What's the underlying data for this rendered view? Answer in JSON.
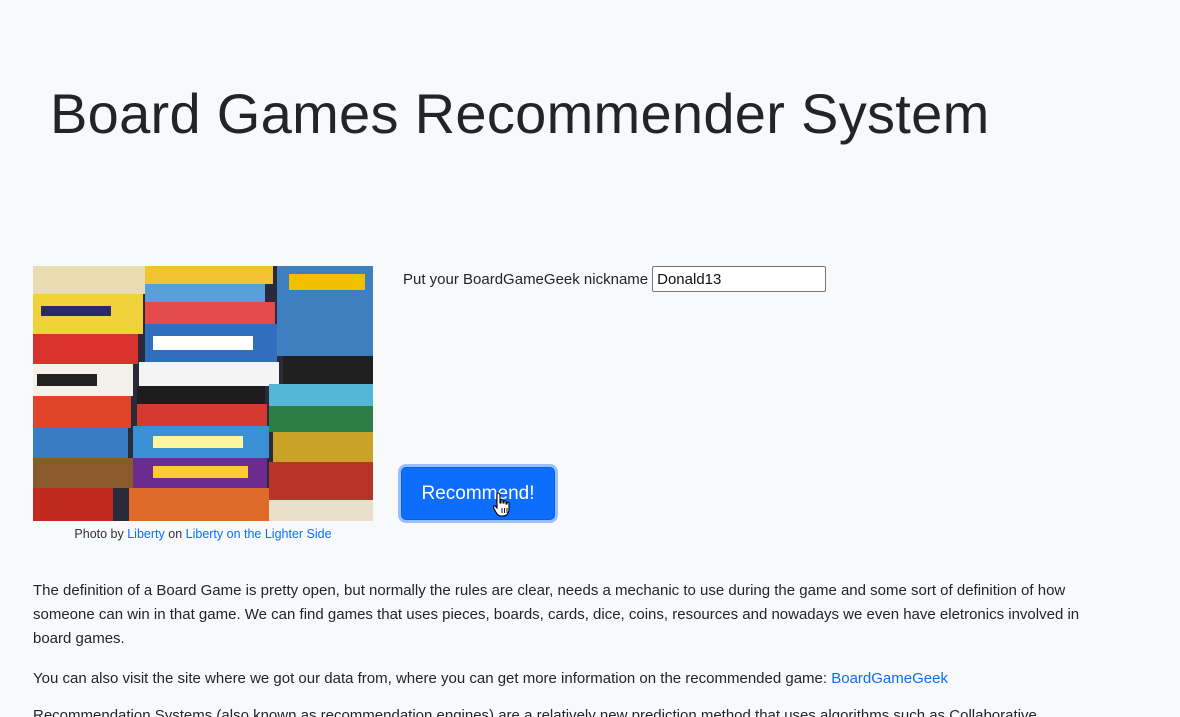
{
  "header": {
    "title": "Board Games Recommender System"
  },
  "photo": {
    "caption_prefix": "Photo by",
    "author_link": "Liberty",
    "caption_middle": "on",
    "source_link": "Liberty on the Lighter Side"
  },
  "form": {
    "nickname_label": "Put your BoardGameGeek nickname",
    "nickname_value": "Donald13",
    "submit_label": "Recommend!"
  },
  "content": {
    "paragraph1": "The definition of a Board Game is pretty open, but normally the rules are clear, needs a mechanic to use during the game and some sort of definition of how someone can win in that game. We can find games that uses pieces, boards, cards, dice, coins, resources and nowadays we even have eletronics involved in board games.",
    "paragraph2_text": "You can also visit the site where we got our data from, where you can get more information on the recommended game:",
    "paragraph2_link": "BoardGameGeek",
    "paragraph3": "Recommendation Systems (also known as recommendation engines) are a relatively new prediction method that uses algorithms such as Collaborative"
  },
  "colors": {
    "accent": "#0d6efd",
    "background": "#f8f9fa",
    "text": "#212529"
  }
}
